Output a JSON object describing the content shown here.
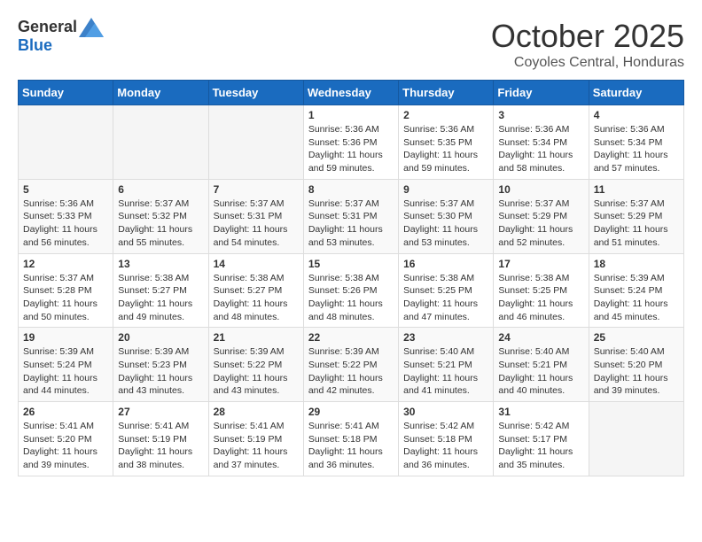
{
  "header": {
    "logo": {
      "text_general": "General",
      "text_blue": "Blue"
    },
    "month": "October 2025",
    "location": "Coyoles Central, Honduras"
  },
  "weekdays": [
    "Sunday",
    "Monday",
    "Tuesday",
    "Wednesday",
    "Thursday",
    "Friday",
    "Saturday"
  ],
  "weeks": [
    [
      {
        "day": "",
        "sunrise": "",
        "sunset": "",
        "daylight": ""
      },
      {
        "day": "",
        "sunrise": "",
        "sunset": "",
        "daylight": ""
      },
      {
        "day": "",
        "sunrise": "",
        "sunset": "",
        "daylight": ""
      },
      {
        "day": "1",
        "sunrise": "Sunrise: 5:36 AM",
        "sunset": "Sunset: 5:36 PM",
        "daylight": "Daylight: 11 hours and 59 minutes."
      },
      {
        "day": "2",
        "sunrise": "Sunrise: 5:36 AM",
        "sunset": "Sunset: 5:35 PM",
        "daylight": "Daylight: 11 hours and 59 minutes."
      },
      {
        "day": "3",
        "sunrise": "Sunrise: 5:36 AM",
        "sunset": "Sunset: 5:34 PM",
        "daylight": "Daylight: 11 hours and 58 minutes."
      },
      {
        "day": "4",
        "sunrise": "Sunrise: 5:36 AM",
        "sunset": "Sunset: 5:34 PM",
        "daylight": "Daylight: 11 hours and 57 minutes."
      }
    ],
    [
      {
        "day": "5",
        "sunrise": "Sunrise: 5:36 AM",
        "sunset": "Sunset: 5:33 PM",
        "daylight": "Daylight: 11 hours and 56 minutes."
      },
      {
        "day": "6",
        "sunrise": "Sunrise: 5:37 AM",
        "sunset": "Sunset: 5:32 PM",
        "daylight": "Daylight: 11 hours and 55 minutes."
      },
      {
        "day": "7",
        "sunrise": "Sunrise: 5:37 AM",
        "sunset": "Sunset: 5:31 PM",
        "daylight": "Daylight: 11 hours and 54 minutes."
      },
      {
        "day": "8",
        "sunrise": "Sunrise: 5:37 AM",
        "sunset": "Sunset: 5:31 PM",
        "daylight": "Daylight: 11 hours and 53 minutes."
      },
      {
        "day": "9",
        "sunrise": "Sunrise: 5:37 AM",
        "sunset": "Sunset: 5:30 PM",
        "daylight": "Daylight: 11 hours and 53 minutes."
      },
      {
        "day": "10",
        "sunrise": "Sunrise: 5:37 AM",
        "sunset": "Sunset: 5:29 PM",
        "daylight": "Daylight: 11 hours and 52 minutes."
      },
      {
        "day": "11",
        "sunrise": "Sunrise: 5:37 AM",
        "sunset": "Sunset: 5:29 PM",
        "daylight": "Daylight: 11 hours and 51 minutes."
      }
    ],
    [
      {
        "day": "12",
        "sunrise": "Sunrise: 5:37 AM",
        "sunset": "Sunset: 5:28 PM",
        "daylight": "Daylight: 11 hours and 50 minutes."
      },
      {
        "day": "13",
        "sunrise": "Sunrise: 5:38 AM",
        "sunset": "Sunset: 5:27 PM",
        "daylight": "Daylight: 11 hours and 49 minutes."
      },
      {
        "day": "14",
        "sunrise": "Sunrise: 5:38 AM",
        "sunset": "Sunset: 5:27 PM",
        "daylight": "Daylight: 11 hours and 48 minutes."
      },
      {
        "day": "15",
        "sunrise": "Sunrise: 5:38 AM",
        "sunset": "Sunset: 5:26 PM",
        "daylight": "Daylight: 11 hours and 48 minutes."
      },
      {
        "day": "16",
        "sunrise": "Sunrise: 5:38 AM",
        "sunset": "Sunset: 5:25 PM",
        "daylight": "Daylight: 11 hours and 47 minutes."
      },
      {
        "day": "17",
        "sunrise": "Sunrise: 5:38 AM",
        "sunset": "Sunset: 5:25 PM",
        "daylight": "Daylight: 11 hours and 46 minutes."
      },
      {
        "day": "18",
        "sunrise": "Sunrise: 5:39 AM",
        "sunset": "Sunset: 5:24 PM",
        "daylight": "Daylight: 11 hours and 45 minutes."
      }
    ],
    [
      {
        "day": "19",
        "sunrise": "Sunrise: 5:39 AM",
        "sunset": "Sunset: 5:24 PM",
        "daylight": "Daylight: 11 hours and 44 minutes."
      },
      {
        "day": "20",
        "sunrise": "Sunrise: 5:39 AM",
        "sunset": "Sunset: 5:23 PM",
        "daylight": "Daylight: 11 hours and 43 minutes."
      },
      {
        "day": "21",
        "sunrise": "Sunrise: 5:39 AM",
        "sunset": "Sunset: 5:22 PM",
        "daylight": "Daylight: 11 hours and 43 minutes."
      },
      {
        "day": "22",
        "sunrise": "Sunrise: 5:39 AM",
        "sunset": "Sunset: 5:22 PM",
        "daylight": "Daylight: 11 hours and 42 minutes."
      },
      {
        "day": "23",
        "sunrise": "Sunrise: 5:40 AM",
        "sunset": "Sunset: 5:21 PM",
        "daylight": "Daylight: 11 hours and 41 minutes."
      },
      {
        "day": "24",
        "sunrise": "Sunrise: 5:40 AM",
        "sunset": "Sunset: 5:21 PM",
        "daylight": "Daylight: 11 hours and 40 minutes."
      },
      {
        "day": "25",
        "sunrise": "Sunrise: 5:40 AM",
        "sunset": "Sunset: 5:20 PM",
        "daylight": "Daylight: 11 hours and 39 minutes."
      }
    ],
    [
      {
        "day": "26",
        "sunrise": "Sunrise: 5:41 AM",
        "sunset": "Sunset: 5:20 PM",
        "daylight": "Daylight: 11 hours and 39 minutes."
      },
      {
        "day": "27",
        "sunrise": "Sunrise: 5:41 AM",
        "sunset": "Sunset: 5:19 PM",
        "daylight": "Daylight: 11 hours and 38 minutes."
      },
      {
        "day": "28",
        "sunrise": "Sunrise: 5:41 AM",
        "sunset": "Sunset: 5:19 PM",
        "daylight": "Daylight: 11 hours and 37 minutes."
      },
      {
        "day": "29",
        "sunrise": "Sunrise: 5:41 AM",
        "sunset": "Sunset: 5:18 PM",
        "daylight": "Daylight: 11 hours and 36 minutes."
      },
      {
        "day": "30",
        "sunrise": "Sunrise: 5:42 AM",
        "sunset": "Sunset: 5:18 PM",
        "daylight": "Daylight: 11 hours and 36 minutes."
      },
      {
        "day": "31",
        "sunrise": "Sunrise: 5:42 AM",
        "sunset": "Sunset: 5:17 PM",
        "daylight": "Daylight: 11 hours and 35 minutes."
      },
      {
        "day": "",
        "sunrise": "",
        "sunset": "",
        "daylight": ""
      }
    ]
  ]
}
